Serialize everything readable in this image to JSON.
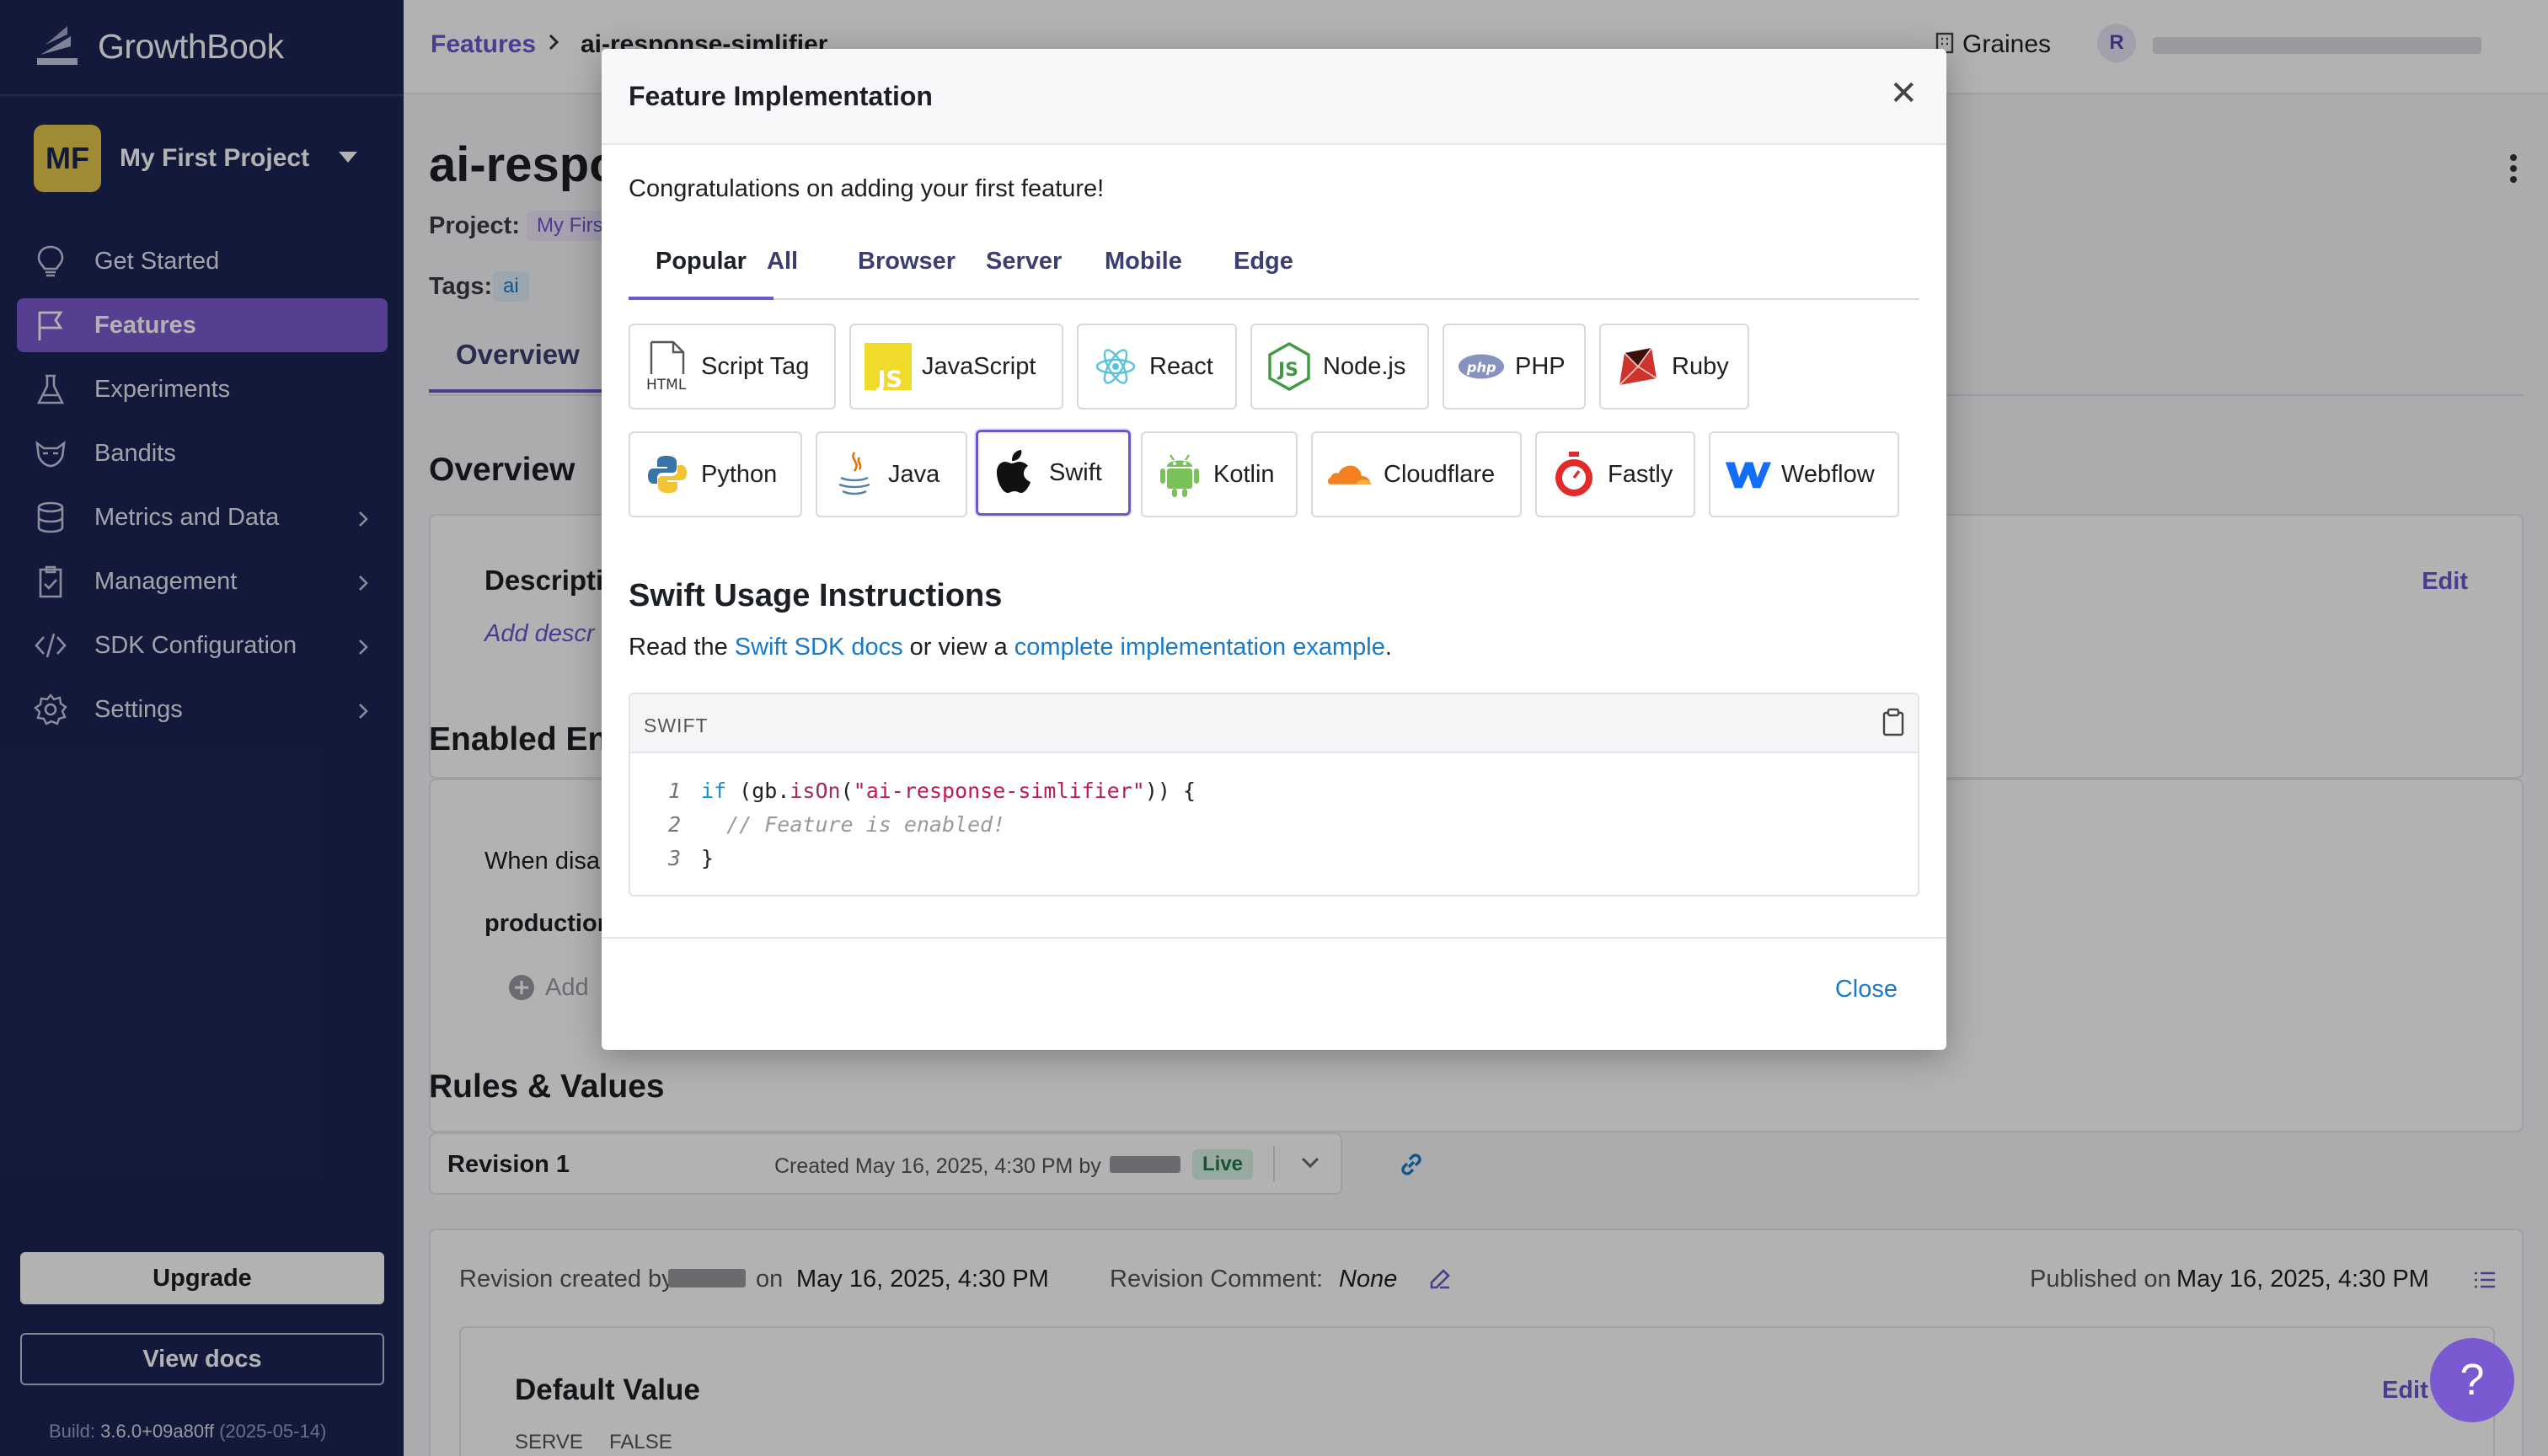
{
  "app": {
    "name": "GrowthBook"
  },
  "sidebar": {
    "project": {
      "initials": "MF",
      "name": "My First Project"
    },
    "items": [
      {
        "label": "Get Started",
        "icon": "lightbulb-icon"
      },
      {
        "label": "Features",
        "icon": "flag-icon",
        "active": true
      },
      {
        "label": "Experiments",
        "icon": "flask-icon"
      },
      {
        "label": "Bandits",
        "icon": "bandit-icon"
      },
      {
        "label": "Metrics and Data",
        "icon": "database-icon",
        "has_submenu": true
      },
      {
        "label": "Management",
        "icon": "clipboard-icon",
        "has_submenu": true
      },
      {
        "label": "SDK Configuration",
        "icon": "code-icon",
        "has_submenu": true
      },
      {
        "label": "Settings",
        "icon": "gear-icon",
        "has_submenu": true
      }
    ],
    "upgrade_label": "Upgrade",
    "view_docs_label": "View docs",
    "build_label": "Build:",
    "build_version": "3.6.0+09a80ff",
    "build_date": "(2025-05-14)"
  },
  "topbar": {
    "breadcrumb_root": "Features",
    "breadcrumb_current": "ai-response-simlifier",
    "org_name": "Graines",
    "user_initial": "R"
  },
  "page": {
    "title": "ai-respo",
    "project_label": "Project:",
    "project_value": "My Firs",
    "tags_label": "Tags:",
    "tag": "ai",
    "tab_overview": "Overview",
    "overview_heading": "Overview",
    "description_heading": "Descripti",
    "description_placeholder": "Add descr",
    "edit_label": "Edit",
    "enabled_env_heading": "Enabled Env",
    "when_disabled_text": "When disa",
    "production_label": "production",
    "add_label": "Add",
    "rules_heading": "Rules & Values",
    "revision_label": "Revision 1",
    "revision_created": "Created May 16, 2025, 4:30 PM by",
    "revision_status": "Live",
    "revision_created_by_prefix": "Revision created by",
    "revision_created_on": "on",
    "revision_date": "May 16, 2025, 4:30 PM",
    "revision_comment_label": "Revision Comment:",
    "revision_comment_value": "None",
    "published_label": "Published on",
    "published_date": "May 16, 2025, 4:30 PM",
    "default_value_heading": "Default Value",
    "default_edit_label": "Edit",
    "serve_label": "SERVE",
    "serve_value": "FALSE"
  },
  "modal": {
    "title": "Feature Implementation",
    "congrats": "Congratulations on adding your first feature!",
    "tabs": [
      "Popular",
      "All",
      "Browser",
      "Server",
      "Mobile",
      "Edge"
    ],
    "active_tab": "Popular",
    "languages_row1": [
      {
        "label": "Script Tag",
        "icon": "html-file-icon"
      },
      {
        "label": "JavaScript",
        "icon": "javascript-icon"
      },
      {
        "label": "React",
        "icon": "react-icon"
      },
      {
        "label": "Node.js",
        "icon": "nodejs-icon"
      },
      {
        "label": "PHP",
        "icon": "php-icon"
      },
      {
        "label": "Ruby",
        "icon": "ruby-icon"
      }
    ],
    "languages_row2": [
      {
        "label": "Python",
        "icon": "python-icon"
      },
      {
        "label": "Java",
        "icon": "java-icon"
      },
      {
        "label": "Swift",
        "icon": "apple-icon",
        "active": true
      },
      {
        "label": "Kotlin",
        "icon": "android-icon"
      },
      {
        "label": "Cloudflare",
        "icon": "cloudflare-icon"
      },
      {
        "label": "Fastly",
        "icon": "fastly-icon"
      },
      {
        "label": "Webflow",
        "icon": "webflow-icon"
      }
    ],
    "usage_heading": "Swift Usage Instructions",
    "usage_prefix": "Read the",
    "usage_link1": "Swift SDK docs",
    "usage_middle": "or view a",
    "usage_link2": "complete implementation example",
    "usage_suffix": ".",
    "code_lang": "SWIFT",
    "code": {
      "line_numbers": [
        "1",
        "2",
        "3"
      ],
      "l1_kw": "if",
      "l1_a": " (gb.",
      "l1_fn": "isOn",
      "l1_b": "(",
      "l1_str": "\"ai-response-simlifier\"",
      "l1_c": ")) {",
      "l2_comment": "  // Feature is enabled!",
      "l3": "}"
    },
    "close_label": "Close"
  },
  "help_label": "?",
  "colors": {
    "sidebar_bg": "#1c2554",
    "accent": "#7b59d0",
    "link": "#1a7ac8"
  }
}
